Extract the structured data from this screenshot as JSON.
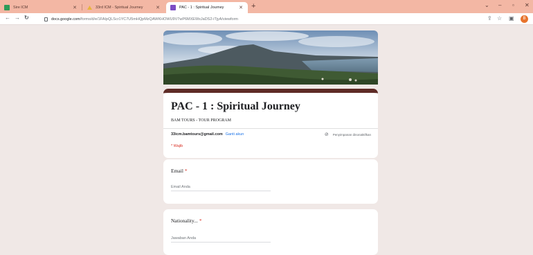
{
  "browser": {
    "tabs": [
      {
        "title": "Sire ICM",
        "favicon": "sheets-icon"
      },
      {
        "title": "33rd ICM - Spiritual Journey",
        "favicon": "drive-icon"
      },
      {
        "title": "PAC - 1 : Spiritual Journey",
        "favicon": "forms-icon",
        "active": true
      }
    ],
    "new_tab": "+",
    "url_host": "docs.google.com",
    "url_path": "/forms/d/e/1FAIpQLScr1YC7U5mHQpMzQAWKHOWU9V7wP6MXEWxJaDS2-iTjyA/viewform",
    "profile_initial": "B"
  },
  "form": {
    "title": "PAC - 1 : Spiritual Journey",
    "description": "BAM TOURS - TOUR PROGRAM",
    "account_email": "33icm.bamtours@gmail.com",
    "switch_account": "Ganti akun",
    "not_saved": "Penyimpanan dinonaktifkan",
    "required_note": "* Wajib",
    "questions": [
      {
        "label": "Email",
        "required": "*",
        "placeholder": "Email Anda"
      },
      {
        "label": "Nationality...",
        "required": "*",
        "placeholder": "Jawaban Anda"
      }
    ]
  },
  "colors": {
    "theme": "#5e2b26",
    "page_bg": "#f0e8e6",
    "tab_strip": "#f3b7a4",
    "required": "#d93025",
    "link": "#1a73e8"
  }
}
